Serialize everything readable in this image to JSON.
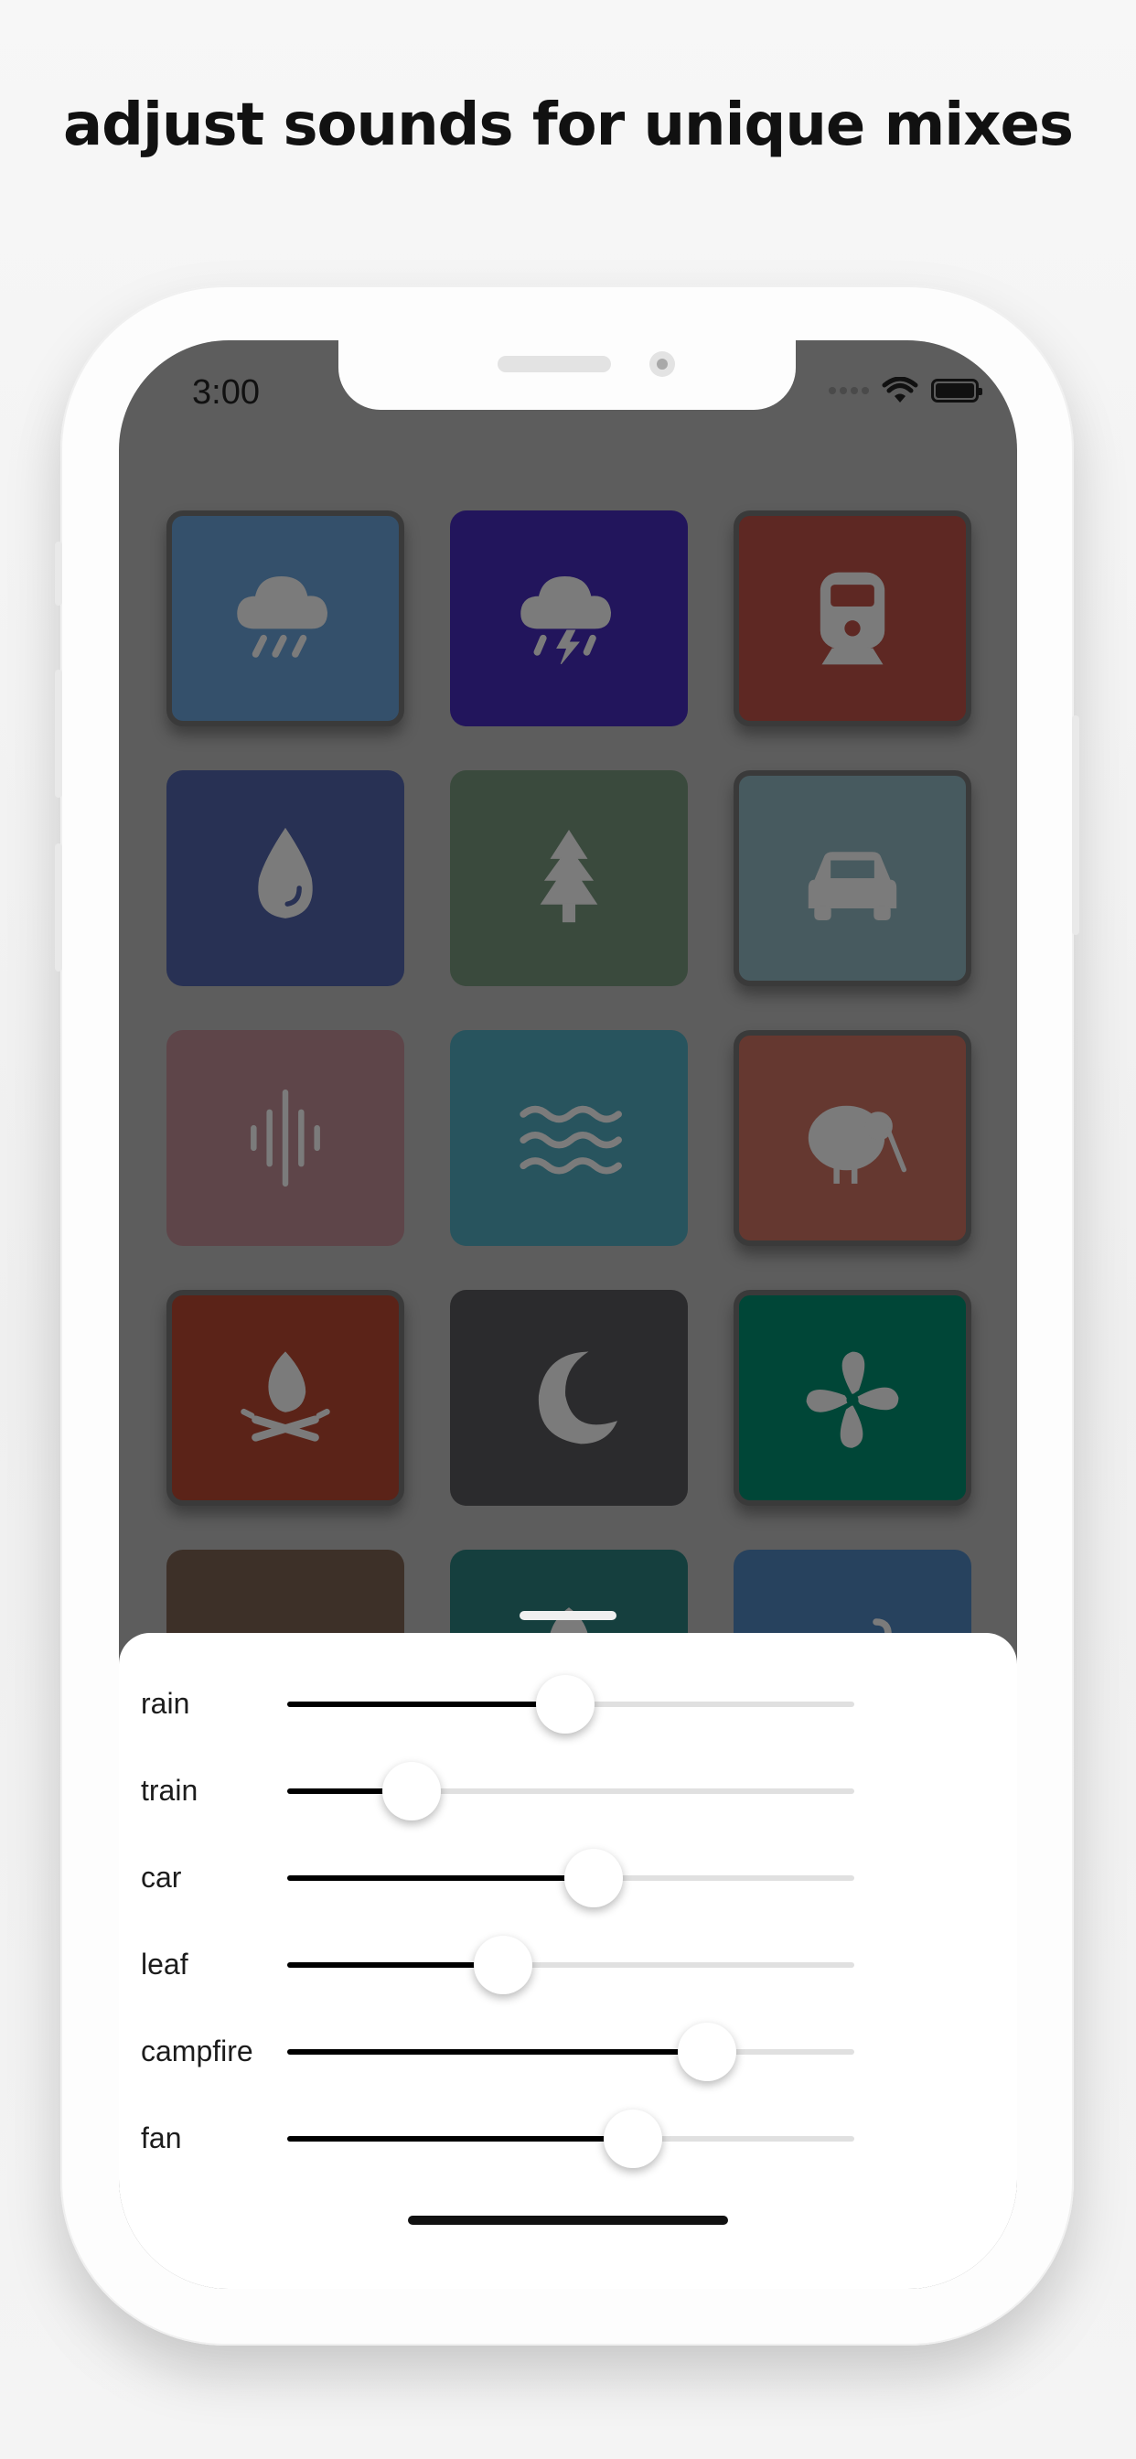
{
  "headline": "adjust sounds for unique mixes",
  "status_bar": {
    "time": "3:00"
  },
  "tiles": [
    {
      "icon": "rain-cloud-icon",
      "color": "#34506b",
      "selected": true
    },
    {
      "icon": "thunderstorm-icon",
      "color": "#22155c",
      "selected": false
    },
    {
      "icon": "train-icon",
      "color": "#5e2823",
      "selected": true
    },
    {
      "icon": "water-drop-icon",
      "color": "#283154",
      "selected": false
    },
    {
      "icon": "pine-tree-icon",
      "color": "#3a4a3d",
      "selected": false
    },
    {
      "icon": "car-icon",
      "color": "#475a5f",
      "selected": true
    },
    {
      "icon": "sound-wave-icon",
      "color": "#5e4549",
      "selected": false
    },
    {
      "icon": "waves-icon",
      "color": "#28545e",
      "selected": false
    },
    {
      "icon": "kiwi-bird-icon",
      "color": "#653830",
      "selected": true
    },
    {
      "icon": "campfire-icon",
      "color": "#5b2318",
      "selected": true
    },
    {
      "icon": "moon-icon",
      "color": "#2b2b2d",
      "selected": false
    },
    {
      "icon": "fan-icon",
      "color": "#004637",
      "selected": true
    },
    {
      "icon": "coffee-cup-icon",
      "color": "#3d3028",
      "selected": false
    },
    {
      "icon": "leaf-icon",
      "color": "#153f3e",
      "selected": false
    },
    {
      "icon": "wind-icon",
      "color": "#27425e",
      "selected": false
    }
  ],
  "sliders": [
    {
      "label": "rain",
      "value": 0.49
    },
    {
      "label": "train",
      "value": 0.22
    },
    {
      "label": "car",
      "value": 0.54
    },
    {
      "label": "leaf",
      "value": 0.38
    },
    {
      "label": "campfire",
      "value": 0.74
    },
    {
      "label": "fan",
      "value": 0.61
    }
  ]
}
